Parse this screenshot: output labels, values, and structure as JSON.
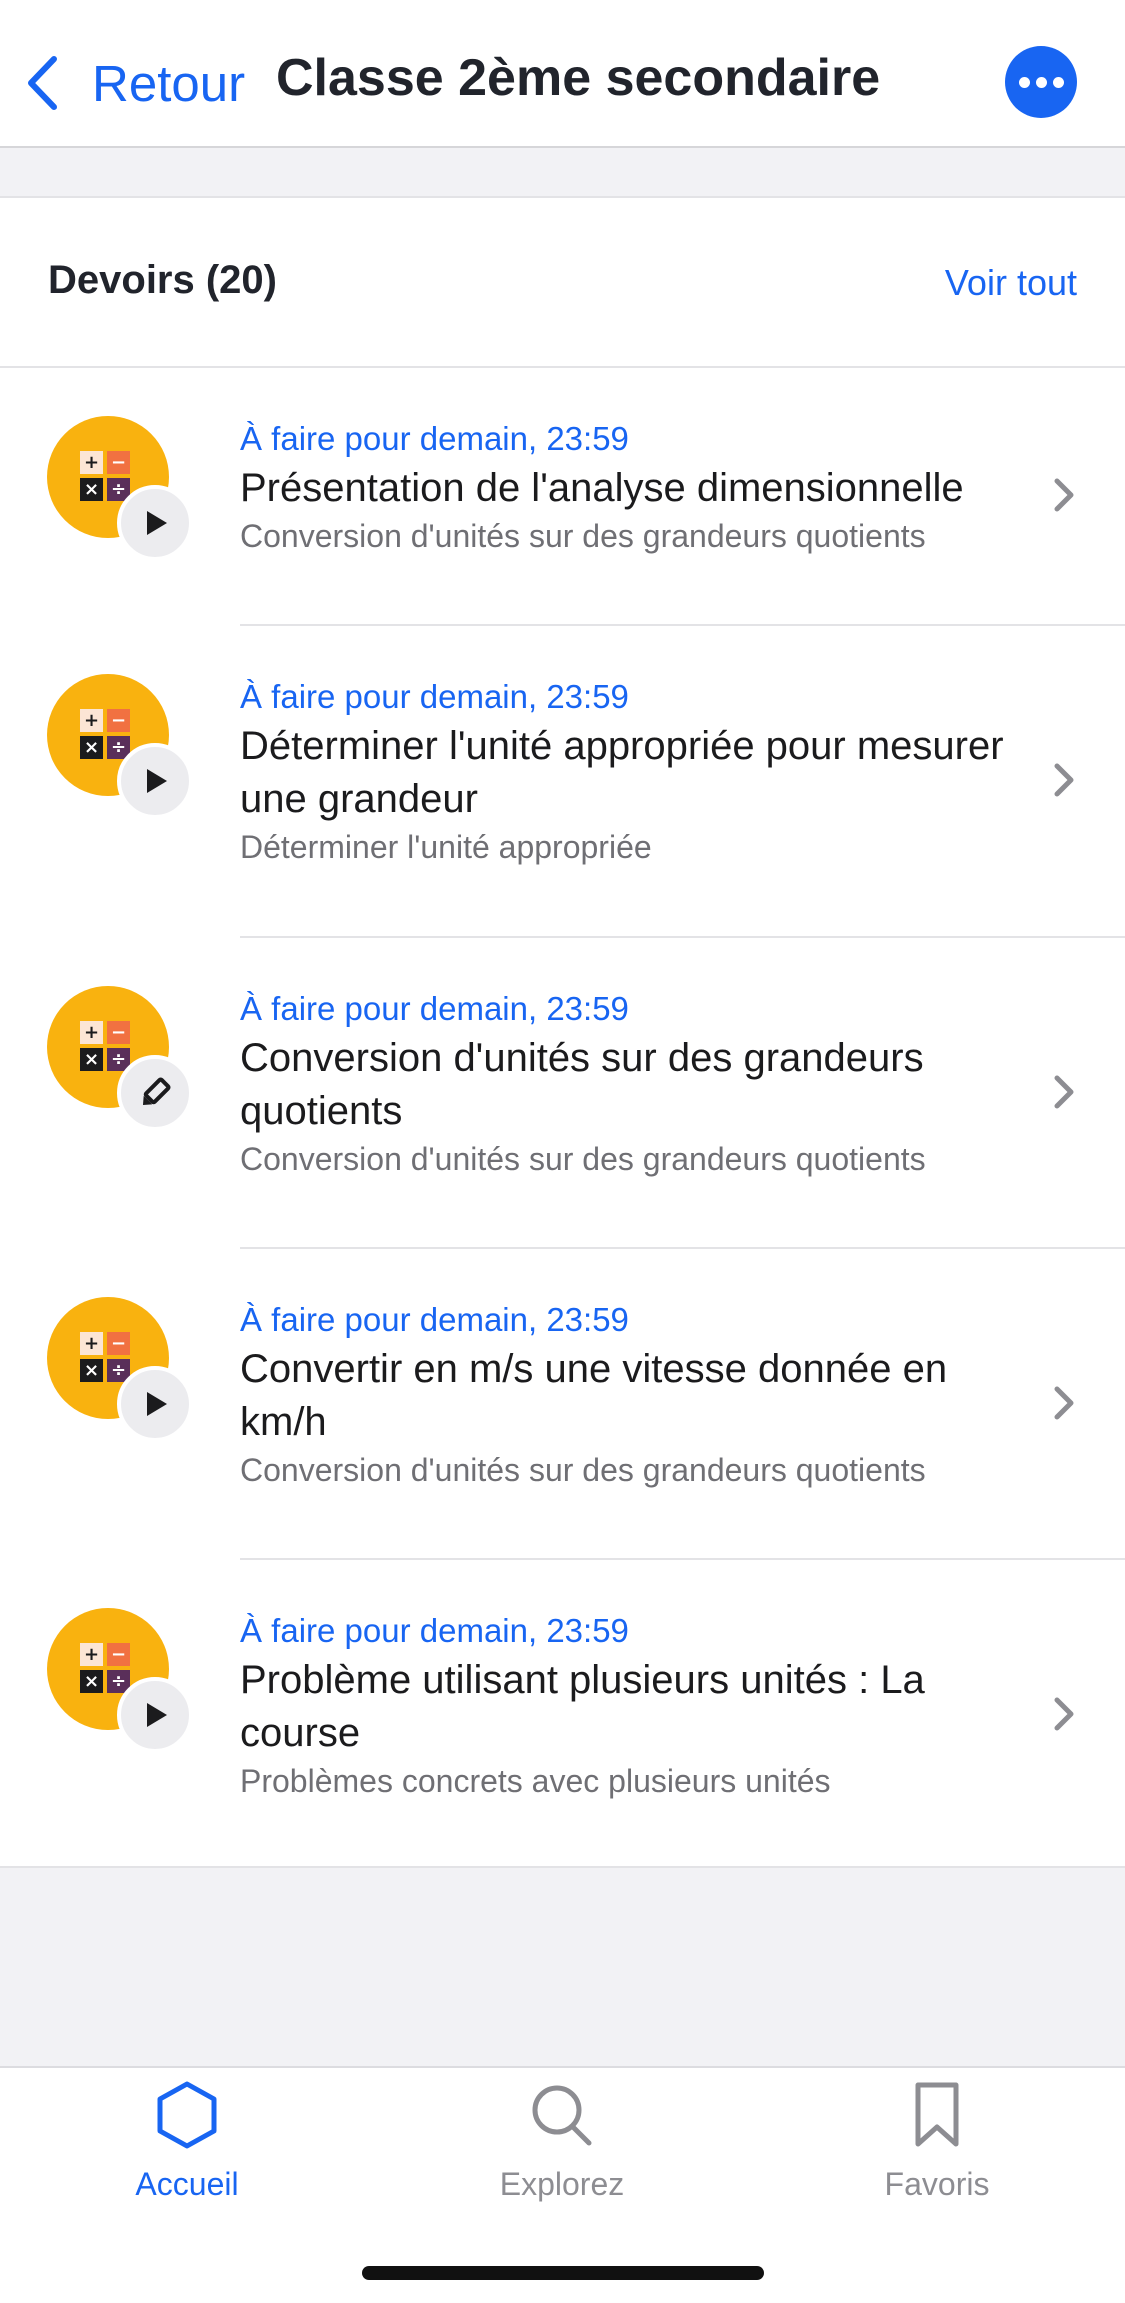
{
  "header": {
    "back_label": "Retour",
    "title": "Classe 2ème secondaire",
    "more_icon": "ellipsis-icon"
  },
  "section": {
    "title": "Devoirs (20)",
    "see_all": "Voir tout"
  },
  "assignments": [
    {
      "due": "À faire pour demain, 23:59",
      "title": "Présentation de l'analyse dimensionnelle",
      "subtitle": "Conversion d'unités sur des grandeurs quotients",
      "type_icon": "play-icon"
    },
    {
      "due": "À faire pour demain, 23:59",
      "title": "Déterminer l'unité appropriée pour mesurer une grandeur",
      "subtitle": "Déterminer l'unité appropriée",
      "type_icon": "play-icon"
    },
    {
      "due": "À faire pour demain, 23:59",
      "title": "Conversion d'unités sur des grandeurs quotients",
      "subtitle": "Conversion d'unités sur des grandeurs quotients",
      "type_icon": "pencil-icon"
    },
    {
      "due": "À faire pour demain, 23:59",
      "title": "Convertir en m/s une vitesse donnée en km/h",
      "subtitle": "Conversion d'unités sur des grandeurs quotients",
      "type_icon": "play-icon"
    },
    {
      "due": "À faire pour demain, 23:59",
      "title": "Problème utilisant plusieurs unités : La course",
      "subtitle": "Problèmes concrets avec plusieurs unités",
      "type_icon": "play-icon"
    }
  ],
  "calculator_icon": {
    "symbols": [
      "+",
      "−",
      "×",
      "÷"
    ]
  },
  "tabs": [
    {
      "label": "Accueil",
      "icon": "hexagon-icon",
      "active": true
    },
    {
      "label": "Explorez",
      "icon": "search-icon",
      "active": false
    },
    {
      "label": "Favoris",
      "icon": "bookmark-icon",
      "active": false
    }
  ],
  "colors": {
    "accent": "#1865f2",
    "avatar": "#f9b20f",
    "inactive_tab": "#8d8d92",
    "background": "#f2f2f5"
  }
}
